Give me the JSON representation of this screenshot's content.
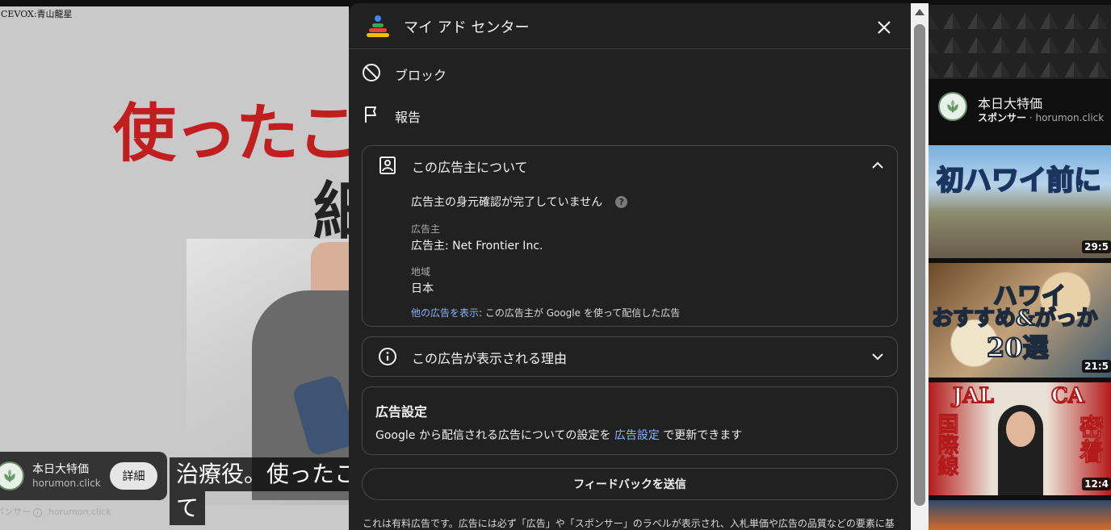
{
  "video": {
    "watermark": "CEVOX:青山龍星",
    "headline1": "使ったこ",
    "headline2": "細",
    "caption_line1": "治療役。使ったこ",
    "caption_line2": "て"
  },
  "ad_overlay": {
    "advertiser": "本日大特価",
    "domain": "horumon.click",
    "details_button": "詳細",
    "sponsor_prefix": "ポンサー",
    "sponsor_domain": "horumon.click"
  },
  "dialog": {
    "title": "マイ アド センター",
    "close_icon": "close-icon",
    "block_label": "ブロック",
    "report_label": "報告",
    "about_section": {
      "title": "この広告主について",
      "verification_status": "広告主の身元確認が完了していません",
      "advertiser_label": "広告主",
      "advertiser_value": "広告主: Net Frontier Inc.",
      "region_label": "地域",
      "region_value": "日本",
      "more_ads_link": "他の広告を表示",
      "more_ads_desc": ": この広告主が Google を使って配信した広告"
    },
    "why_section": {
      "title": "この広告が表示される理由"
    },
    "ad_settings": {
      "title": "広告設定",
      "desc_before": "Google から配信される広告についての設定を ",
      "link": "広告設定",
      "desc_after": " で更新できます"
    },
    "feedback_button": "フィードバックを送信",
    "footer_note": "これは有料広告です。広告には必ず「広告」や「スポンサー」のラベルが表示され、入札単価や広告の品質などの要素に基"
  },
  "sidebar": {
    "sponsor_card": {
      "title": "本日大特価",
      "sponsor_label": "スポンサー",
      "domain": "horumon.click"
    },
    "thumbnails": [
      {
        "title": "初ハワイ前に",
        "duration": "29:5"
      },
      {
        "title_line1": "ハワイ",
        "title_line2": "おすすめ&がっか",
        "title_line3": "20選",
        "duration": "21:5"
      },
      {
        "title_left": "JAL",
        "title_right": "CA",
        "side_left": "国際線",
        "side_right": "密着",
        "duration": "12:4"
      }
    ]
  },
  "colors": {
    "dialog_bg": "#212121",
    "link": "#8ab4f8",
    "headline_red": "#c11f1f"
  }
}
